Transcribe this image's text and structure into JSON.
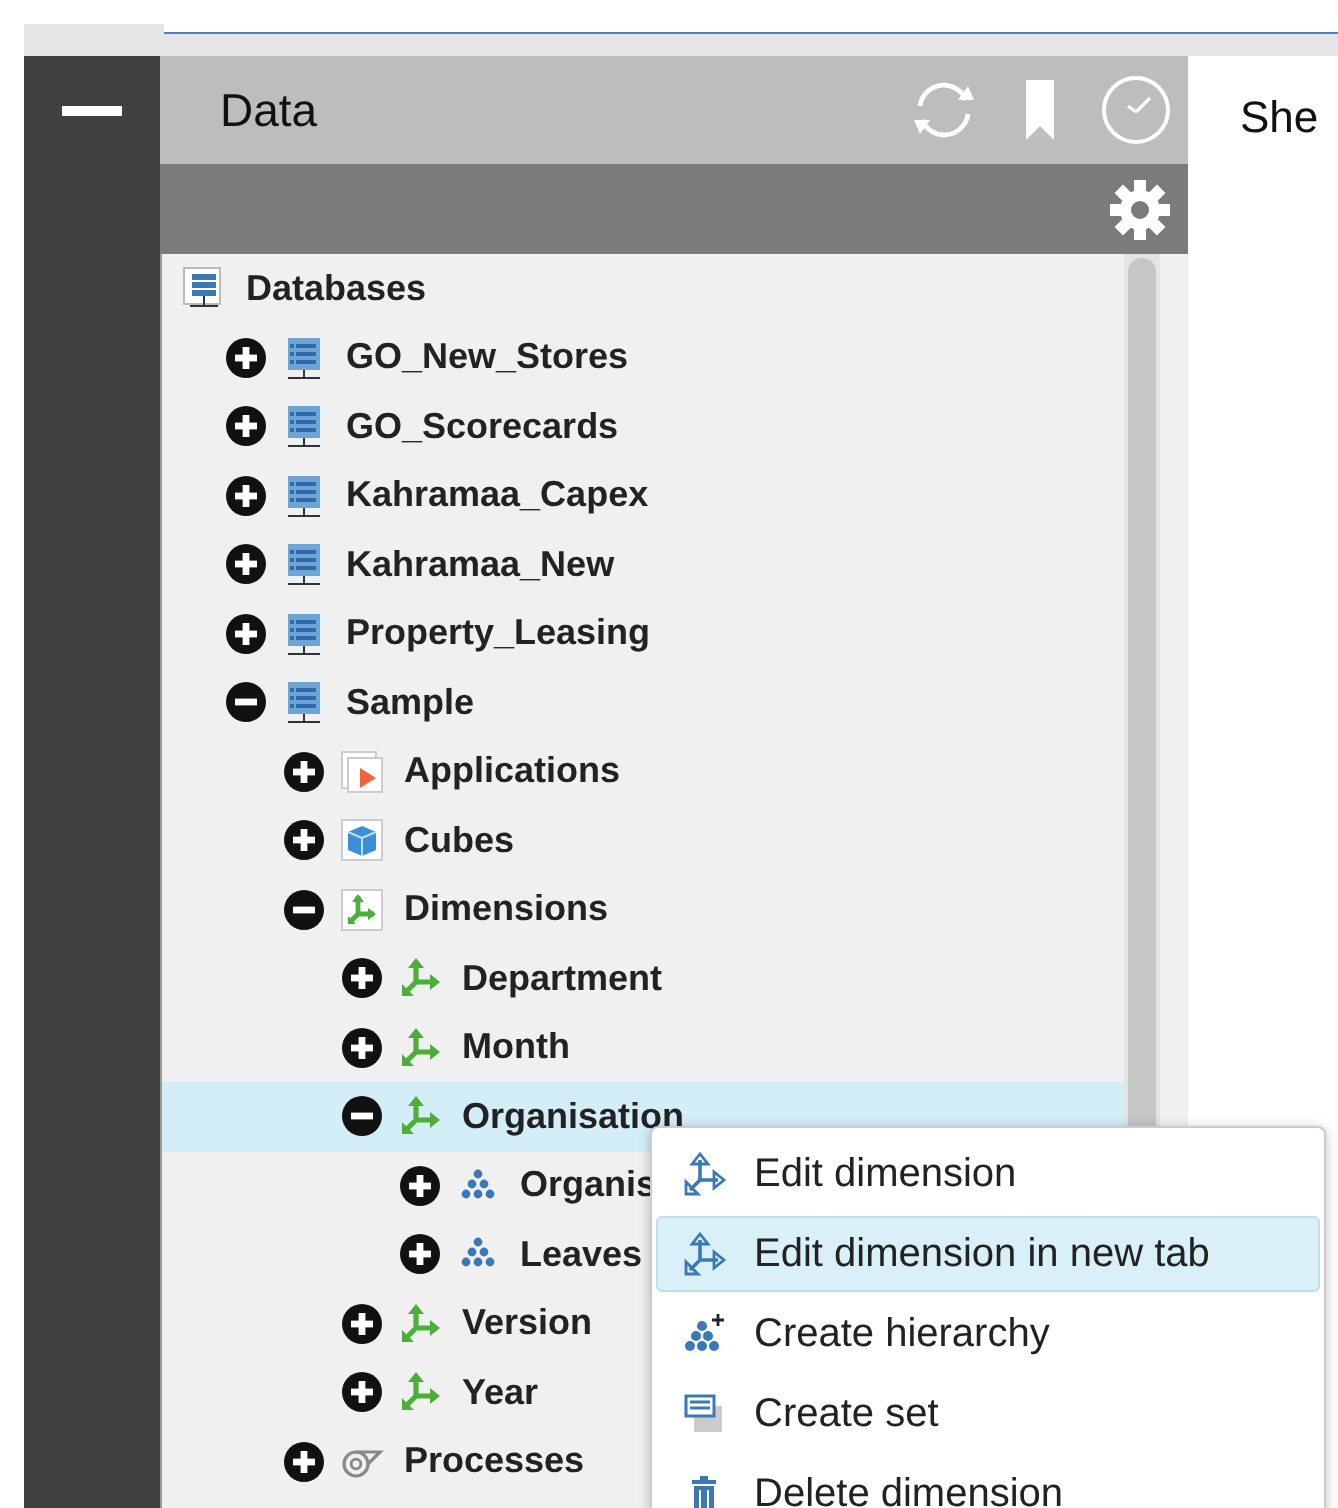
{
  "panel": {
    "title": "Data"
  },
  "tree": [
    {
      "label": "Databases",
      "kind": "database-root",
      "selected": false,
      "children": [
        {
          "label": "GO_New_Stores",
          "kind": "database",
          "expanded": false,
          "selected": false
        },
        {
          "label": "GO_Scorecards",
          "kind": "database",
          "expanded": false,
          "selected": false
        },
        {
          "label": "Kahramaa_Capex",
          "kind": "database",
          "expanded": false,
          "selected": false
        },
        {
          "label": "Kahramaa_New",
          "kind": "database",
          "expanded": false,
          "selected": false
        },
        {
          "label": "Property_Leasing",
          "kind": "database",
          "expanded": false,
          "selected": false
        },
        {
          "label": "Sample",
          "kind": "database",
          "expanded": true,
          "selected": false,
          "children": [
            {
              "label": "Applications",
              "kind": "applications",
              "expanded": false,
              "selected": false
            },
            {
              "label": "Cubes",
              "kind": "cubes",
              "expanded": false,
              "selected": false
            },
            {
              "label": "Dimensions",
              "kind": "dimensions",
              "expanded": true,
              "selected": false,
              "children": [
                {
                  "label": "Department",
                  "kind": "dimension",
                  "expanded": false,
                  "selected": false
                },
                {
                  "label": "Month",
                  "kind": "dimension",
                  "expanded": false,
                  "selected": false
                },
                {
                  "label": "Organisation",
                  "kind": "dimension",
                  "expanded": true,
                  "selected": true,
                  "children": [
                    {
                      "label": "Organis",
                      "kind": "hierarchy",
                      "expanded": false,
                      "selected": false
                    },
                    {
                      "label": "Leaves",
                      "kind": "hierarchy",
                      "expanded": false,
                      "selected": false
                    }
                  ]
                },
                {
                  "label": "Version",
                  "kind": "dimension",
                  "expanded": false,
                  "selected": false
                },
                {
                  "label": "Year",
                  "kind": "dimension",
                  "expanded": false,
                  "selected": false
                }
              ]
            },
            {
              "label": "Processes",
              "kind": "processes",
              "expanded": false,
              "selected": false
            }
          ]
        }
      ]
    }
  ],
  "context_menu": [
    {
      "label": "Edit dimension",
      "kind": "edit",
      "selected": false
    },
    {
      "label": "Edit dimension in new tab",
      "kind": "edit",
      "selected": true
    },
    {
      "label": "Create hierarchy",
      "kind": "hierarchy-add",
      "selected": false
    },
    {
      "label": "Create set",
      "kind": "set",
      "selected": false
    },
    {
      "label": "Delete dimension",
      "kind": "trash",
      "selected": false
    }
  ],
  "sheet": {
    "title": "She"
  }
}
